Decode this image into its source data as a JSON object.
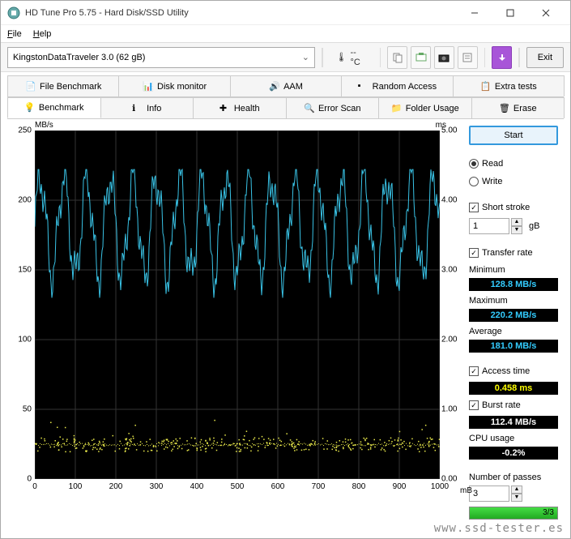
{
  "window": {
    "title": "HD Tune Pro 5.75 - Hard Disk/SSD Utility"
  },
  "menu": {
    "file": "File",
    "help": "Help"
  },
  "toolbar": {
    "device": "KingstonDataTraveler 3.0 (62 gB)",
    "temp": "-- °C",
    "exit": "Exit"
  },
  "tabs_row1": [
    "File Benchmark",
    "Disk monitor",
    "AAM",
    "Random Access",
    "Extra tests"
  ],
  "tabs_row2": [
    "Benchmark",
    "Info",
    "Health",
    "Error Scan",
    "Folder Usage",
    "Erase"
  ],
  "active_tab": "Benchmark",
  "sidebar": {
    "start": "Start",
    "read": "Read",
    "write": "Write",
    "short_stroke": "Short stroke",
    "short_val": "1",
    "short_unit": "gB",
    "transfer_rate": "Transfer rate",
    "min_l": "Minimum",
    "min_v": "128.8 MB/s",
    "max_l": "Maximum",
    "max_v": "220.2 MB/s",
    "avg_l": "Average",
    "avg_v": "181.0 MB/s",
    "access_l": "Access time",
    "access_v": "0.458 ms",
    "burst_l": "Burst rate",
    "burst_v": "112.4 MB/s",
    "cpu_l": "CPU usage",
    "cpu_v": "-0.2%",
    "passes_l": "Number of passes",
    "passes_v": "3",
    "progress": "3/3"
  },
  "watermark": "www.ssd-tester.es",
  "chart_data": {
    "type": "line",
    "xlabel": "mB",
    "ylabel_left": "MB/s",
    "ylabel_right": "ms",
    "xlim": [
      0,
      1000
    ],
    "ylim_left": [
      0,
      250
    ],
    "ylim_right": [
      0,
      5
    ],
    "x_ticks": [
      0,
      100,
      200,
      300,
      400,
      500,
      600,
      700,
      800,
      900,
      1000
    ],
    "y_ticks_left": [
      0,
      50,
      100,
      150,
      200,
      250
    ],
    "y_ticks_right": [
      0,
      1,
      2,
      3,
      4,
      5
    ],
    "series": [
      {
        "name": "Transfer rate",
        "axis": "left",
        "color": "#39c3e6",
        "note": "oscillating signal approx 128–220 MB/s across full range, mean ~181",
        "sample_values": [
          180,
          160,
          210,
          155,
          205,
          150,
          215,
          160,
          200,
          170,
          190
        ]
      },
      {
        "name": "Access time",
        "axis": "right",
        "color": "#e8e84a",
        "note": "scatter cloud around 0.4–0.6 ms with band near 0.5",
        "typical": 0.458
      }
    ]
  }
}
